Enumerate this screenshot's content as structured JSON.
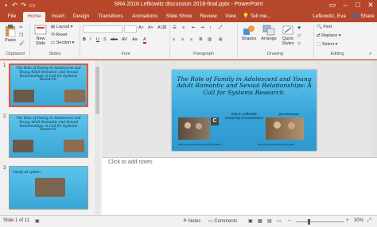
{
  "window": {
    "title": "SRA 2018 Lefkowitz discussion 2018-final.pptx - PowerPoint",
    "controls": [
      "restore-icon",
      "minimize-icon",
      "maximize-icon",
      "close-icon"
    ]
  },
  "tabs": [
    {
      "label": "File"
    },
    {
      "label": "Home",
      "active": true
    },
    {
      "label": "Insert"
    },
    {
      "label": "Design"
    },
    {
      "label": "Transitions"
    },
    {
      "label": "Animations"
    },
    {
      "label": "Slide Show"
    },
    {
      "label": "Review"
    },
    {
      "label": "View"
    },
    {
      "label": "Tell me..."
    }
  ],
  "account": {
    "name": "Lefkowitz, Eva",
    "share": "Share"
  },
  "ribbon": {
    "clipboard": {
      "label": "Clipboard",
      "paste": "Paste"
    },
    "slides": {
      "label": "Slides",
      "new_slide": "New Slide",
      "layout": "Layout",
      "reset": "Reset",
      "section": "Section"
    },
    "font": {
      "label": "Font"
    },
    "paragraph": {
      "label": "Paragraph"
    },
    "drawing": {
      "label": "Drawing",
      "shapes": "Shapes",
      "arrange": "Arrange",
      "quick_styles": "Quick Styles"
    },
    "editing": {
      "label": "Editing",
      "find": "Find",
      "replace": "Replace",
      "select": "Select"
    }
  },
  "thumbnails": [
    {
      "num": "1",
      "title": "The Role of Family in Adolescent and Young Adult Romantic and Sexual Relationships: A Call for Systems Research.",
      "selected": true
    },
    {
      "num": "2",
      "title": "The Role of Family in Adolescent and Young Adult Romantic and Sexual Relationships: A Call for Systems Research.",
      "selected": false
    },
    {
      "num": "3",
      "title": "Family as system",
      "selected": false
    }
  ],
  "slide": {
    "title": "The Role of Family in Adolescent and Young Adult Romantic and Sexual Relationships: A Call for Systems Research.",
    "author": "Eva S. Lefkowitz",
    "affiliation": "University of Connecticut",
    "handle": "@evalefkowitz",
    "link_left": "https://www.youtube.com/watch?v=abctm",
    "link_right": "http://www.evasresearch.com/talks"
  },
  "notes": {
    "placeholder": "Click to add notes"
  },
  "status": {
    "slide": "Slide 1 of 11",
    "notes": "Notes",
    "comments": "Comments",
    "zoom": "30%"
  },
  "colors": {
    "accent": "#b7472a",
    "slide_bg": "#3aa6d6"
  }
}
